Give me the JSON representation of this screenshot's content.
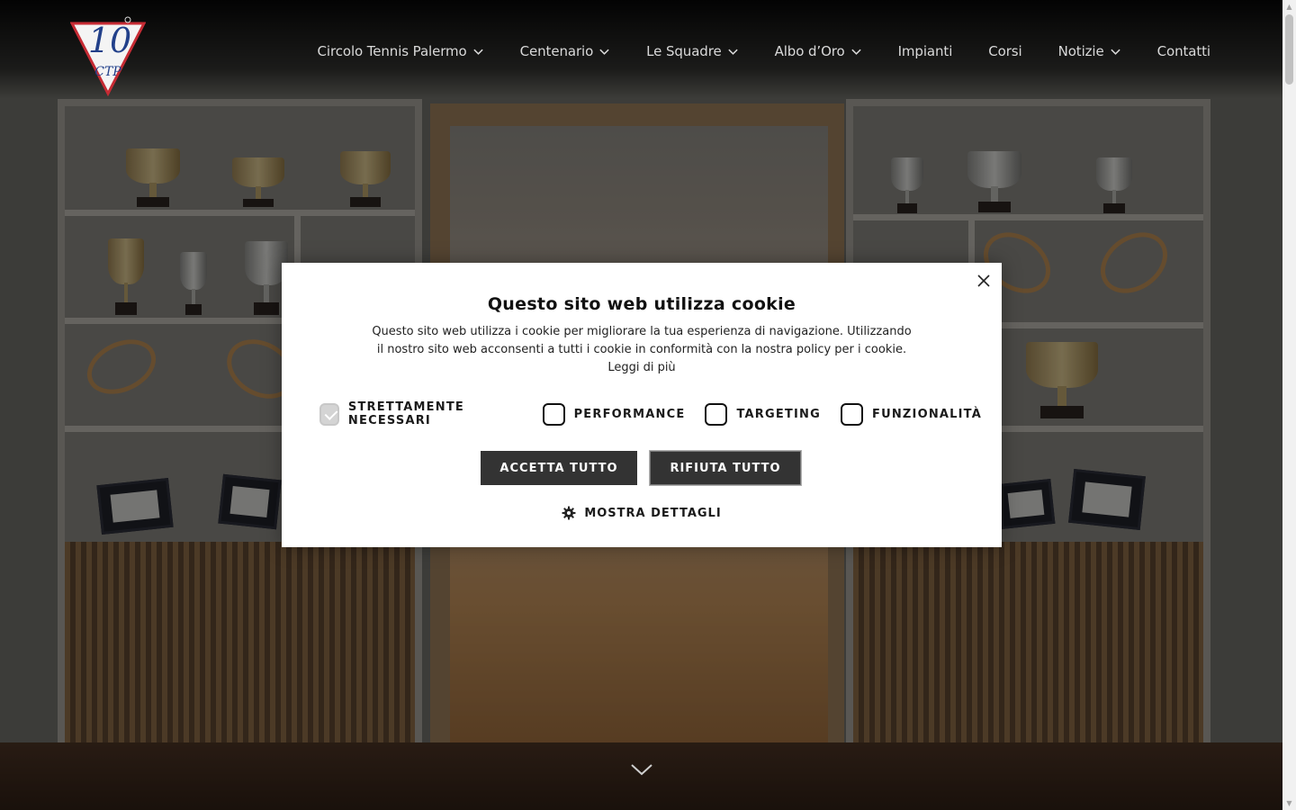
{
  "header": {
    "logo_alt": "100 CTP",
    "nav": [
      {
        "label": "Circolo Tennis Palermo",
        "has_dropdown": true
      },
      {
        "label": "Centenario",
        "has_dropdown": true
      },
      {
        "label": "Le Squadre",
        "has_dropdown": true
      },
      {
        "label": "Albo d’Oro",
        "has_dropdown": true
      },
      {
        "label": "Impianti",
        "has_dropdown": false
      },
      {
        "label": "Corsi",
        "has_dropdown": false
      },
      {
        "label": "Notizie",
        "has_dropdown": true
      },
      {
        "label": "Contatti",
        "has_dropdown": false
      }
    ]
  },
  "cookie_modal": {
    "title": "Questo sito web utilizza cookie",
    "description": "Questo sito web utilizza i cookie per migliorare la tua esperienza di navigazione. Utilizzando il nostro sito web acconsenti a tutti i cookie in conformità con la nostra policy per i cookie.",
    "read_more": "Leggi di più",
    "categories": [
      {
        "label": "STRETTAMENTE NECESSARI",
        "checked": true,
        "disabled": true
      },
      {
        "label": "PERFORMANCE",
        "checked": false
      },
      {
        "label": "TARGETING",
        "checked": false
      },
      {
        "label": "FUNZIONALITÀ",
        "checked": false
      }
    ],
    "accept_label": "ACCETTA TUTTO",
    "reject_label": "RIFIUTA TUTTO",
    "details_label": "MOSTRA DETTAGLI"
  },
  "icons": {
    "close": "close-icon",
    "gear": "gear-icon",
    "chevron": "chevron-down-icon",
    "scroll_down": "chevron-down-icon"
  },
  "colors": {
    "nav_text": "#d9d9d9",
    "button_bg": "#333333",
    "logo_red": "#c62b34",
    "logo_blue": "#22408a"
  }
}
